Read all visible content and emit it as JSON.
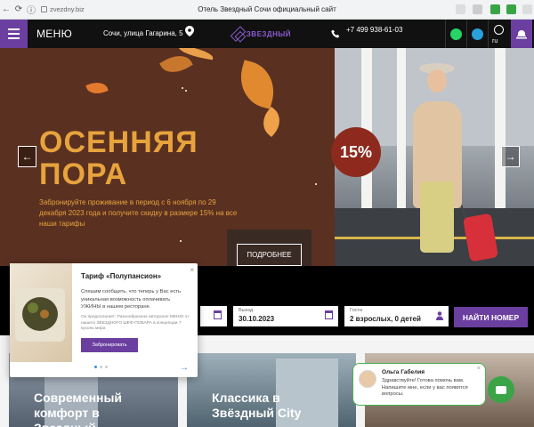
{
  "browser": {
    "url": "zvezdny.biz",
    "title": "Отель Звездный Сочи официальный сайт"
  },
  "header": {
    "menu_label": "МЕНЮ",
    "address": "Сочи, улица Гагарина, 5",
    "logo_text": "ЗВЕЗДНЫЙ",
    "phone": "+7 499 938-61-03",
    "lang": "ru"
  },
  "hero": {
    "title_line1": "ОСЕННЯЯ",
    "title_line2": "ПОРА",
    "description": "Забронируйте проживание в период с 6 ноября по 29 декабря 2023 года и получите скидку в размере 15% на все наши тарифы",
    "badge": "15%",
    "cta_label": "ПОДРОБНЕЕ",
    "prev_arrow": "←",
    "next_arrow": "→"
  },
  "booking": {
    "checkout_label": "Выезд",
    "checkout_value": "30.10.2023",
    "guests_label": "Гости",
    "guests_value": "2 взрослых, 0 детей",
    "find_button": "НАЙТИ НОМЕР"
  },
  "cards": [
    {
      "caption": "Современный комфорт в Звездный"
    },
    {
      "caption": "Классика в Звёздный City"
    }
  ],
  "popup": {
    "title": "Тариф «Полупансион»",
    "body": "Спешим сообщить, что теперь у Вас есть уникальная возможность оплачивать УЖИНЫ в нашем ресторане.",
    "small": "Он предполагает: Разнообразное авторское МЕНЮ от нашего ЗВЕЗДНОГО ШЕФ-ПОВАРА в концепции 7 кухонь мира",
    "button": "Забронировать",
    "close": "×",
    "next": "→"
  },
  "chat": {
    "name": "Ольга Габелия",
    "message": "Здравствуйте! Готова помочь вам. Напишите мне, если у вас появятся вопросы.",
    "close": "×"
  },
  "colors": {
    "brand": "#6b3fa0",
    "hero_bg": "#5a3021",
    "hero_text": "#e7a33c",
    "badge": "#8d2a1d",
    "chat_green": "#3aa447"
  }
}
